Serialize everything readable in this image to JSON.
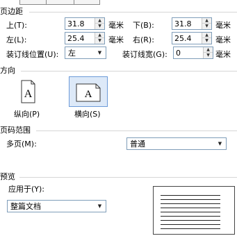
{
  "margins": {
    "section_title": "页边距",
    "top": {
      "label": "上(T):",
      "value": "31.8",
      "unit": "毫米"
    },
    "bottom": {
      "label": "下(B):",
      "value": "31.8",
      "unit": "毫米"
    },
    "left": {
      "label": "左(L):",
      "value": "25.4",
      "unit": "毫米"
    },
    "right": {
      "label": "右(R):",
      "value": "25.4",
      "unit": "毫米"
    },
    "gutter_position": {
      "label": "装订线位置(U):",
      "value": "左"
    },
    "gutter_width": {
      "label": "装订线宽(G):",
      "value": "0",
      "unit": "毫米"
    }
  },
  "orientation": {
    "section_title": "方向",
    "portrait": {
      "label": "纵向(P)",
      "glyph": "A"
    },
    "landscape": {
      "label": "横向(S)",
      "glyph": "A",
      "selected": true
    }
  },
  "page_range": {
    "section_title": "页码范围",
    "multiple_pages": {
      "label": "多页(M):",
      "value": "普通"
    }
  },
  "preview": {
    "section_title": "预览",
    "apply_to": {
      "label": "应用于(Y):",
      "value": "整篇文档"
    }
  }
}
